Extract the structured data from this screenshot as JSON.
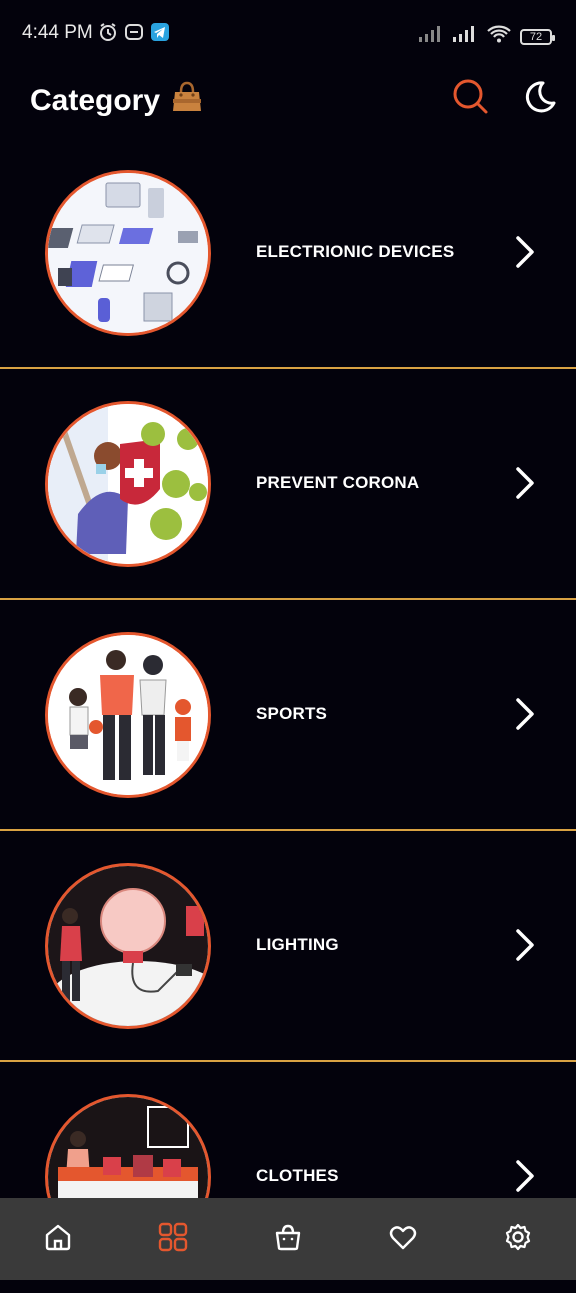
{
  "status_bar": {
    "time": "4:44 PM",
    "battery": "72",
    "icons": [
      "alarm-icon",
      "app-icon",
      "telegram-icon",
      "signal-icon",
      "signal-icon",
      "wifi-icon",
      "battery-icon"
    ]
  },
  "header": {
    "title": "Category",
    "title_icon": "shopping-bag-emoji",
    "actions": [
      "search-icon",
      "dark-mode-moon-icon"
    ]
  },
  "categories": [
    {
      "label": "ELECTRIONIC DEVICES",
      "image": "electronic-devices-illustration"
    },
    {
      "label": "PREVENT CORONA",
      "image": "prevent-corona-illustration"
    },
    {
      "label": "SPORTS",
      "image": "sports-family-illustration"
    },
    {
      "label": "LIGHTING",
      "image": "lightbulb-illustration"
    },
    {
      "label": "CLOTHES",
      "image": "clothes-store-illustration"
    }
  ],
  "bottom_nav": [
    {
      "name": "home",
      "icon": "home-icon",
      "active": false
    },
    {
      "name": "category",
      "icon": "grid-icon",
      "active": true
    },
    {
      "name": "cart",
      "icon": "shopping-bag-icon",
      "active": false
    },
    {
      "name": "wishlist",
      "icon": "heart-icon",
      "active": false
    },
    {
      "name": "settings",
      "icon": "gear-icon",
      "active": false
    }
  ],
  "colors": {
    "background": "#03020c",
    "accent": "#e4572e",
    "divider": "#d9a243",
    "nav_background": "#3a3a3a"
  }
}
